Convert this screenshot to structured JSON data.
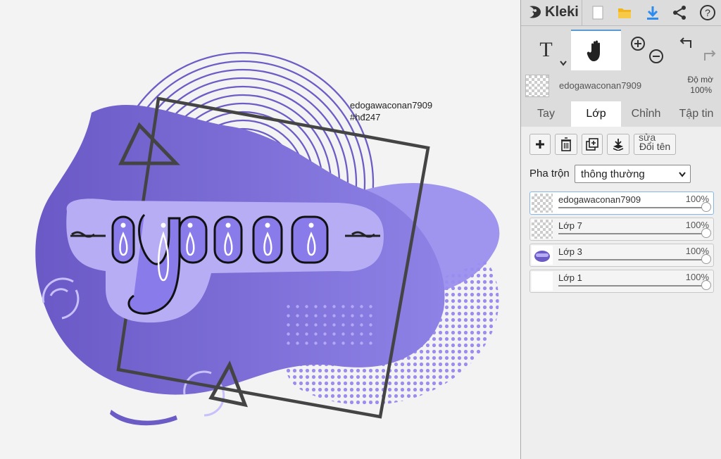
{
  "app": {
    "name": "Kleki",
    "accent_color": "#2d8cf0"
  },
  "topbar": {
    "icons": [
      "new-file-icon",
      "open-folder-icon",
      "download-icon",
      "share-icon",
      "help-icon"
    ]
  },
  "tools": {
    "text_glyph": "T",
    "hand_icon": "hand-icon",
    "zoom_in_icon": "zoom-in-icon",
    "zoom_out_icon": "zoom-out-icon",
    "undo_icon": "undo-icon",
    "redo_icon": "redo-icon"
  },
  "active_layer": {
    "name": "edogawaconan7909",
    "opacity_label": "Độ mờ",
    "opacity_value": "100%"
  },
  "tabs": [
    {
      "label": "Tay",
      "active": false
    },
    {
      "label": "Lớp",
      "active": true
    },
    {
      "label": "Chỉnh",
      "active": false
    },
    {
      "label": "Tập tin",
      "active": false
    }
  ],
  "layer_actions": {
    "rename_top": "sửa",
    "rename_label": "Đổi tên"
  },
  "blend": {
    "label": "Pha trộn",
    "selected": "thông thường"
  },
  "layers": [
    {
      "name": "edogawaconan7909",
      "opacity": "100%",
      "opacity_fraction": 1.0,
      "selected": true
    },
    {
      "name": "Lớp 7",
      "opacity": "100%",
      "opacity_fraction": 1.0,
      "selected": false
    },
    {
      "name": "Lớp 3",
      "opacity": "100%",
      "opacity_fraction": 1.0,
      "selected": false
    },
    {
      "name": "Lớp 1",
      "opacity": "100%",
      "opacity_fraction": 1.0,
      "selected": false
    }
  ],
  "canvas": {
    "caption_line1": "edogawaconan7909",
    "caption_line2": "#hđ247",
    "lettering": "yeeu",
    "colors": {
      "purple_dark": "#6b5bc4",
      "purple_mid": "#8577e0",
      "lavender": "#b9b0f5",
      "frame": "#444444"
    }
  }
}
